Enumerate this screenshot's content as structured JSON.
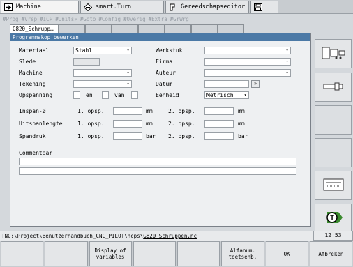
{
  "top_tabs": [
    {
      "label": "Machine",
      "icon": "arrow-right-icon"
    },
    {
      "label": "smart.Turn",
      "icon": "diamond-arrows-icon"
    },
    {
      "label": "Gereedschapseditor",
      "icon": "tool-holder-icon"
    },
    {
      "label": "",
      "icon": "save-icon"
    }
  ],
  "toolbar": [
    "Prog",
    "Vrsp",
    "ICP",
    "Units»",
    "Goto",
    "Config",
    "Overig",
    "Extra",
    "GrWrg"
  ],
  "doc_tab": "G820_Schrupp…",
  "panel": {
    "title": "Programmakop bewerken",
    "materiaal_label": "Materiaal",
    "materiaal_value": "Stahl",
    "slede_label": "Slede",
    "machine_label": "Machine",
    "tekening_label": "Tekening",
    "opspanning_label": "Opspanning",
    "en_label": "en",
    "van_label": "van",
    "werkstuk_label": "Werkstuk",
    "firma_label": "Firma",
    "auteur_label": "Auteur",
    "datum_label": "Datum",
    "datum_btn": "»",
    "eenheid_label": "Eenheid",
    "eenheid_value": "Metrisch",
    "rows": [
      {
        "label": "Inspan-Ø",
        "o1": "1. opsp.",
        "u1": "mm",
        "o2": "2. opsp.",
        "u2": "mm"
      },
      {
        "label": "Uitspanlengte",
        "o1": "1. opsp.",
        "u1": "mm",
        "o2": "2. opsp.",
        "u2": "mm"
      },
      {
        "label": "Spandruk",
        "o1": "1. opsp.",
        "u1": "bar",
        "o2": "2. opsp.",
        "u2": "bar"
      }
    ],
    "commentaar_label": "Commentaar"
  },
  "status_path_prefix": "TNC:\\Project\\Benutzerhandbuch_CNC_PILOT\\ncps\\",
  "status_path_file": "G820_Schruppen.nc",
  "clock": "12:53",
  "bottom_keys": [
    "",
    "",
    "Display of\nvariables",
    "",
    "",
    "Alfanum.\ntoetsenb.",
    "OK",
    "Afbreken"
  ]
}
